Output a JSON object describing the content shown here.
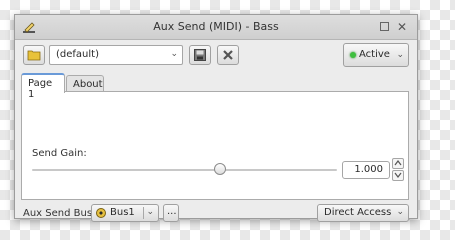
{
  "window": {
    "title": "Aux Send (MIDI) - Bass"
  },
  "toolbar": {
    "preset_value": "(default)",
    "active_label": "Active"
  },
  "tabs": [
    {
      "label": "Page 1"
    },
    {
      "label": "About"
    }
  ],
  "param": {
    "label": "Send Gain:",
    "value": "1.000",
    "slider_fraction": 0.62
  },
  "bottom": {
    "bus_label": "Aux Send Bus:",
    "bus_value": "Bus1",
    "more_label": "...",
    "direct_access_label": "Direct Access"
  },
  "colors": {
    "active_led": "#3fbf3f"
  }
}
